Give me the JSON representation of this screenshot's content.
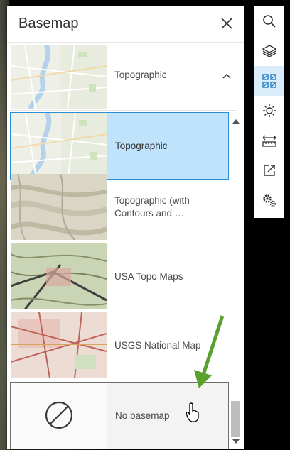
{
  "panel": {
    "title": "Basemap",
    "current": {
      "label": "Topographic"
    }
  },
  "basemaps": [
    {
      "label": "Topographic",
      "selected": true
    },
    {
      "label": "Topographic (with Contours and …",
      "selected": false
    },
    {
      "label": "USA Topo Maps",
      "selected": false
    },
    {
      "label": "USGS National Map",
      "selected": false
    },
    {
      "label": "No basemap",
      "selected": false,
      "hover": true
    }
  ],
  "toolbar": {
    "tools": [
      {
        "name": "search",
        "icon": "search-icon"
      },
      {
        "name": "layers",
        "icon": "layers-icon"
      },
      {
        "name": "basemap",
        "icon": "basemap-gallery-icon",
        "active": true
      },
      {
        "name": "daylight",
        "icon": "sun-icon"
      },
      {
        "name": "measure",
        "icon": "measure-icon"
      },
      {
        "name": "share",
        "icon": "share-icon"
      },
      {
        "name": "settings",
        "icon": "settings-icon"
      }
    ]
  },
  "colors": {
    "selected_bg": "#bfe3fb",
    "selected_border": "#2b8fd6",
    "arrow": "#5aa02c"
  }
}
